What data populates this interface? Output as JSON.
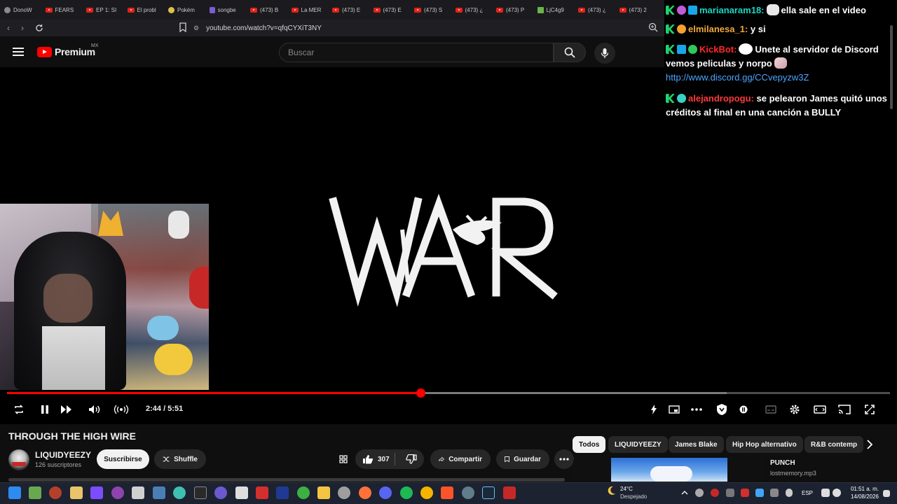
{
  "browser": {
    "tabs": [
      {
        "label": "DonoW",
        "fav": "globe"
      },
      {
        "label": "FEARS",
        "fav": "yt"
      },
      {
        "label": "EP 1: SI",
        "fav": "yt"
      },
      {
        "label": "El probl",
        "fav": "yt"
      },
      {
        "label": "Pokém",
        "fav": "poke"
      },
      {
        "label": "songbe",
        "fav": "purple"
      },
      {
        "label": "(473) B",
        "fav": "yt"
      },
      {
        "label": "La MER",
        "fav": "yt"
      },
      {
        "label": "(473) E",
        "fav": "yt"
      },
      {
        "label": "(473) E",
        "fav": "yt"
      },
      {
        "label": "(473) S",
        "fav": "yt"
      },
      {
        "label": "(473) ¿",
        "fav": "yt"
      },
      {
        "label": "(473) P",
        "fav": "yt"
      },
      {
        "label": "LjC4g9",
        "fav": "green"
      },
      {
        "label": "(473) ¿",
        "fav": "yt"
      },
      {
        "label": "(473) 2",
        "fav": "yt"
      }
    ],
    "url": "youtube.com/watch?v=qfqCYXiT3NY"
  },
  "youtube": {
    "brand": "Premium",
    "region": "MX",
    "search_placeholder": "Buscar"
  },
  "player": {
    "time": "2:44 / 5:51",
    "progress_fraction": 0.468,
    "buffered_fraction": 0.815
  },
  "video": {
    "title": "THROUGH THE HIGH WIRE",
    "channel": "LIQUIDYEEZY",
    "subscribers": "126 suscriptores",
    "subscribe_label": "Suscribirse",
    "shuffle_label": "Shuffle",
    "likes": "307",
    "share_label": "Compartir",
    "save_label": "Guardar"
  },
  "chips": [
    "Todos",
    "LIQUIDYEEZY",
    "James Blake",
    "Hip Hop alternativo",
    "R&B contemp"
  ],
  "suggestion": {
    "title": "PUNCH",
    "subtitle": "lostmemory.mp3"
  },
  "chat": {
    "messages": [
      {
        "user": "marianaram18:",
        "text": "ella sale en el video"
      },
      {
        "user": "elmilanesa_1:",
        "text": "y si"
      },
      {
        "user": "KickBot:",
        "text": "Unete al servidor de Discord vemos peliculas y norpo",
        "link": "http://www.discord.gg/CCvepyzw3Z"
      },
      {
        "user": "alejandropogu:",
        "text": "se pelearon James quitó unos créditos al final en una canción a BULLY"
      }
    ]
  },
  "taskbar": {
    "temp": "24°C",
    "weather": "Despejado",
    "lang": "ESP",
    "time": "01:51 a. m.",
    "date": "14/08/2026"
  },
  "colors": {
    "accent": "#ff0000",
    "background": "#0f0f0f",
    "chat_link": "#4ea5ff"
  }
}
